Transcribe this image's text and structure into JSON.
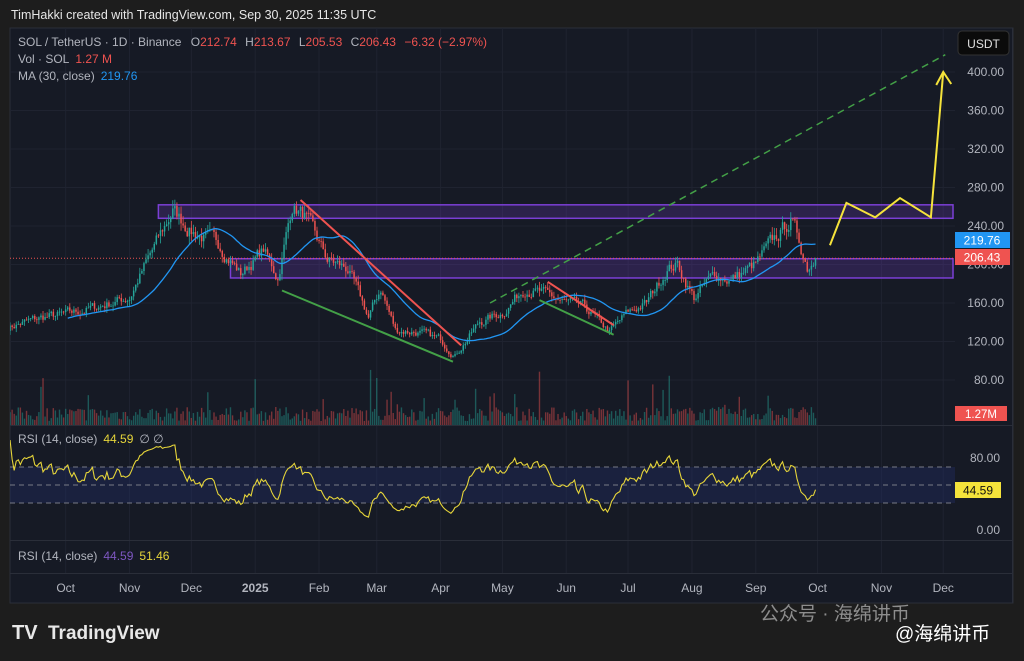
{
  "header": {
    "attribution": "TimHakki created with TradingView.com, Sep 30, 2025 11:35 UTC"
  },
  "legend": {
    "symbol": "SOL / TetherUS · 1D · Binance",
    "o_label": "O",
    "o": "212.74",
    "h_label": "H",
    "h": "213.67",
    "l_label": "L",
    "l": "205.53",
    "c_label": "C",
    "c": "206.43",
    "change": "−6.32 (−2.97%)",
    "vol_label": "Vol · SOL",
    "vol": "1.27 M",
    "ma_label": "MA (30, close)",
    "ma": "219.76"
  },
  "rsi_legend": {
    "label": "RSI (14, close)",
    "value": "44.59",
    "extra": "∅ ∅"
  },
  "rsi2_legend": {
    "label": "RSI (14, close)",
    "value1": "44.59",
    "value2": "51.46"
  },
  "currency_button": "USDT",
  "price_labels": {
    "ma": "219.76",
    "last": "206.43",
    "volume": "1.27M",
    "rsi": "44.59"
  },
  "branding": {
    "logo": "TradingView",
    "watermark1": "公众号 · 海绵讲币",
    "watermark2": "@海绵讲币"
  },
  "colors": {
    "up": "#26a69a",
    "down": "#ef5350",
    "ma": "#2196f3",
    "rsi": "#e6d53a",
    "zone": "#7b3fd6",
    "trend_red": "#ef5350",
    "trend_green": "#43a047",
    "projection": "#f5e33b"
  },
  "chart_data": {
    "type": "candlestick",
    "title": "SOL / TetherUS · 1D · Binance",
    "start_date": "2024-09-03",
    "x_tick_labels": [
      "Oct",
      "Nov",
      "Dec",
      "2025",
      "Feb",
      "Mar",
      "Apr",
      "May",
      "Jun",
      "Jul",
      "Aug",
      "Sep",
      "Oct",
      "Nov",
      "Dec"
    ],
    "x_tick_days": [
      28,
      59,
      89,
      120,
      151,
      179,
      210,
      240,
      271,
      301,
      332,
      363,
      393,
      424,
      454
    ],
    "y_ticks": [
      80,
      120,
      160,
      200,
      240,
      280,
      320,
      360,
      400
    ],
    "y_tick_labels": [
      "80.00",
      "120.00",
      "160.00",
      "200.00",
      "240.00",
      "280.00",
      "320.00",
      "360.00",
      "400.00"
    ],
    "ylim": [
      45,
      425
    ],
    "close_keypoints": [
      [
        0,
        135
      ],
      [
        17,
        145
      ],
      [
        28,
        148
      ],
      [
        42,
        155
      ],
      [
        59,
        166
      ],
      [
        68,
        205
      ],
      [
        80,
        256
      ],
      [
        89,
        235
      ],
      [
        103,
        220
      ],
      [
        113,
        190
      ],
      [
        124,
        215
      ],
      [
        131,
        186
      ],
      [
        138,
        262
      ],
      [
        144,
        250
      ],
      [
        155,
        205
      ],
      [
        165,
        195
      ],
      [
        175,
        145
      ],
      [
        181,
        175
      ],
      [
        188,
        132
      ],
      [
        198,
        130
      ],
      [
        210,
        122
      ],
      [
        217,
        106
      ],
      [
        229,
        140
      ],
      [
        240,
        150
      ],
      [
        251,
        176
      ],
      [
        259,
        170
      ],
      [
        271,
        160
      ],
      [
        280,
        155
      ],
      [
        292,
        130
      ],
      [
        301,
        150
      ],
      [
        310,
        160
      ],
      [
        320,
        196
      ],
      [
        325,
        200
      ],
      [
        333,
        165
      ],
      [
        343,
        190
      ],
      [
        351,
        184
      ],
      [
        363,
        200
      ],
      [
        372,
        226
      ],
      [
        380,
        246
      ],
      [
        384,
        225
      ],
      [
        388,
        198
      ],
      [
        392,
        206.43
      ]
    ],
    "ma_period": 30,
    "rsi_period": 14,
    "rsi_ticks": [
      0,
      80
    ],
    "rsi_tick_labels": [
      "0.00",
      "80.00"
    ],
    "rsi_bands": [
      30,
      50,
      70
    ],
    "annotations": {
      "zones": [
        {
          "from_day": 73,
          "low": 248,
          "high": 262
        },
        {
          "from_day": 108,
          "low": 186,
          "high": 206
        }
      ],
      "trendlines": [
        {
          "color": "red",
          "from": [
            142,
            267
          ],
          "to": [
            220,
            116
          ]
        },
        {
          "color": "green",
          "from": [
            133,
            173
          ],
          "to": [
            216,
            99
          ]
        },
        {
          "color": "red",
          "from": [
            262,
            182
          ],
          "to": [
            294,
            137
          ]
        },
        {
          "color": "green",
          "from": [
            258,
            163
          ],
          "to": [
            294,
            127
          ]
        }
      ],
      "dashed_projection": {
        "from": [
          234,
          160
        ],
        "to": [
          455,
          418
        ]
      },
      "yellow_path": [
        [
          399,
          220
        ],
        [
          407,
          264
        ],
        [
          421,
          249
        ],
        [
          433,
          269
        ],
        [
          448,
          249
        ],
        [
          454,
          400
        ]
      ]
    }
  }
}
